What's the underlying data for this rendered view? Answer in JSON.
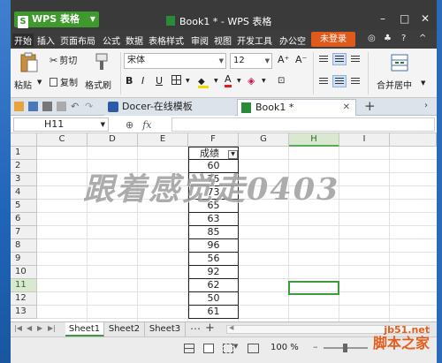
{
  "app": {
    "button_label": "WPS 表格",
    "window_title": "Book1 * - WPS 表格"
  },
  "window_controls": [
    "–",
    "□",
    "✕"
  ],
  "menu": {
    "items": [
      "开始",
      "插入",
      "页面布局",
      "公式",
      "数据",
      "表格样式",
      "审阅",
      "视图",
      "开发工具",
      "办公空"
    ],
    "signin_label": "未登录",
    "right_icons": [
      "◎",
      "♣",
      "?",
      "^"
    ]
  },
  "ribbon": {
    "paste_label": "粘贴",
    "cut_label": "剪切",
    "copy_label": "复制",
    "format_painter_label": "格式刷",
    "font_name": "宋体",
    "font_size": "12",
    "grow_font": "A⁺",
    "shrink_font": "A⁻",
    "bold": "B",
    "italic": "I",
    "underline": "U",
    "font_color_letter": "A",
    "merge_label": "合并居中"
  },
  "tabs": {
    "docer_label": "Docer-在线模板",
    "book_label": "Book1 *",
    "add": "+"
  },
  "formula_bar": {
    "cell_ref": "H11",
    "fx_label": "fx",
    "content": ""
  },
  "grid": {
    "columns": [
      "C",
      "D",
      "E",
      "F",
      "G",
      "H",
      "I"
    ],
    "rows": [
      "1",
      "2",
      "3",
      "4",
      "5",
      "6",
      "7",
      "8",
      "9",
      "10",
      "11",
      "12",
      "13"
    ],
    "selected_column": "H",
    "selected_row": "11",
    "column_f_values": [
      "成绩",
      "60",
      "75",
      "73",
      "65",
      "63",
      "85",
      "96",
      "56",
      "92",
      "62",
      "50",
      "61"
    ]
  },
  "sheets": [
    "Sheet1",
    "Sheet2",
    "Sheet3"
  ],
  "sheet_add": "+",
  "status": {
    "zoom": "100 %"
  },
  "watermark": "跟着感觉走0403",
  "site_watermark": {
    "domain": "jb51.net",
    "name": "脚本之家"
  },
  "colors": {
    "accent_green": "#3f9a2e",
    "signin_orange": "#e05a1c",
    "selection_green": "#3d9a3d",
    "title_bar": "#3a3a3a"
  }
}
